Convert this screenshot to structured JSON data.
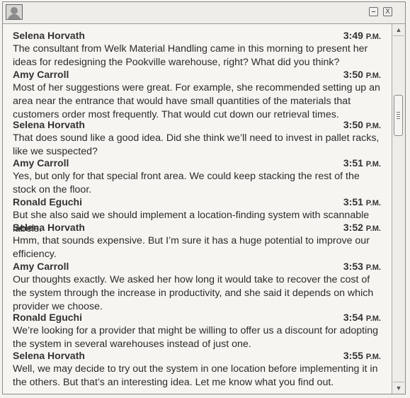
{
  "window": {
    "close_label": "X"
  },
  "messages": [
    {
      "sender": "Selena Horvath",
      "time": "3:49",
      "ampm": "P.M.",
      "text": "The consultant from Welk Material Handling came in this morning to present her ideas for redesigning the Pookville warehouse, right? What did you think?"
    },
    {
      "sender": "Amy Carroll",
      "time": "3:50",
      "ampm": "P.M.",
      "text": "Most of her suggestions were great. For example, she recommended setting up an area near the entrance that would have small quantities of the materials that customers order most frequently. That would cut down our retrieval times."
    },
    {
      "sender": "Selena Horvath",
      "time": "3:50",
      "ampm": "P.M.",
      "text": "That does sound like a good idea. Did she think we’ll need to invest in pallet racks, like we suspected?"
    },
    {
      "sender": "Amy Carroll",
      "time": "3:51",
      "ampm": "P.M.",
      "text": "Yes, but only for that special front area. We could keep stacking the rest of the stock on the floor."
    },
    {
      "sender": "Ronald Eguchi",
      "time": "3:51",
      "ampm": "P.M.",
      "text": "But she also said we should implement a location-finding system with scannable labels."
    },
    {
      "sender": "Selena Horvath",
      "time": "3:52",
      "ampm": "P.M.",
      "text": "Hmm, that sounds expensive. But I’m sure it has a huge potential to improve our efficiency."
    },
    {
      "sender": "Amy Carroll",
      "time": "3:53",
      "ampm": "P.M.",
      "text": "Our thoughts exactly. We asked her how long it would take to recover the cost of the system through the increase in productivity, and she said it depends on which provider we choose."
    },
    {
      "sender": "Ronald Eguchi",
      "time": "3:54",
      "ampm": "P.M.",
      "text": "We’re looking for a provider that might be willing to offer us a discount for adopting the system in several warehouses instead of just one."
    },
    {
      "sender": "Selena Horvath",
      "time": "3:55",
      "ampm": "P.M.",
      "text": "Well, we may decide to try out the system in one location before implementing it in the others. But that’s an interesting idea. Let me know what you find out."
    }
  ]
}
